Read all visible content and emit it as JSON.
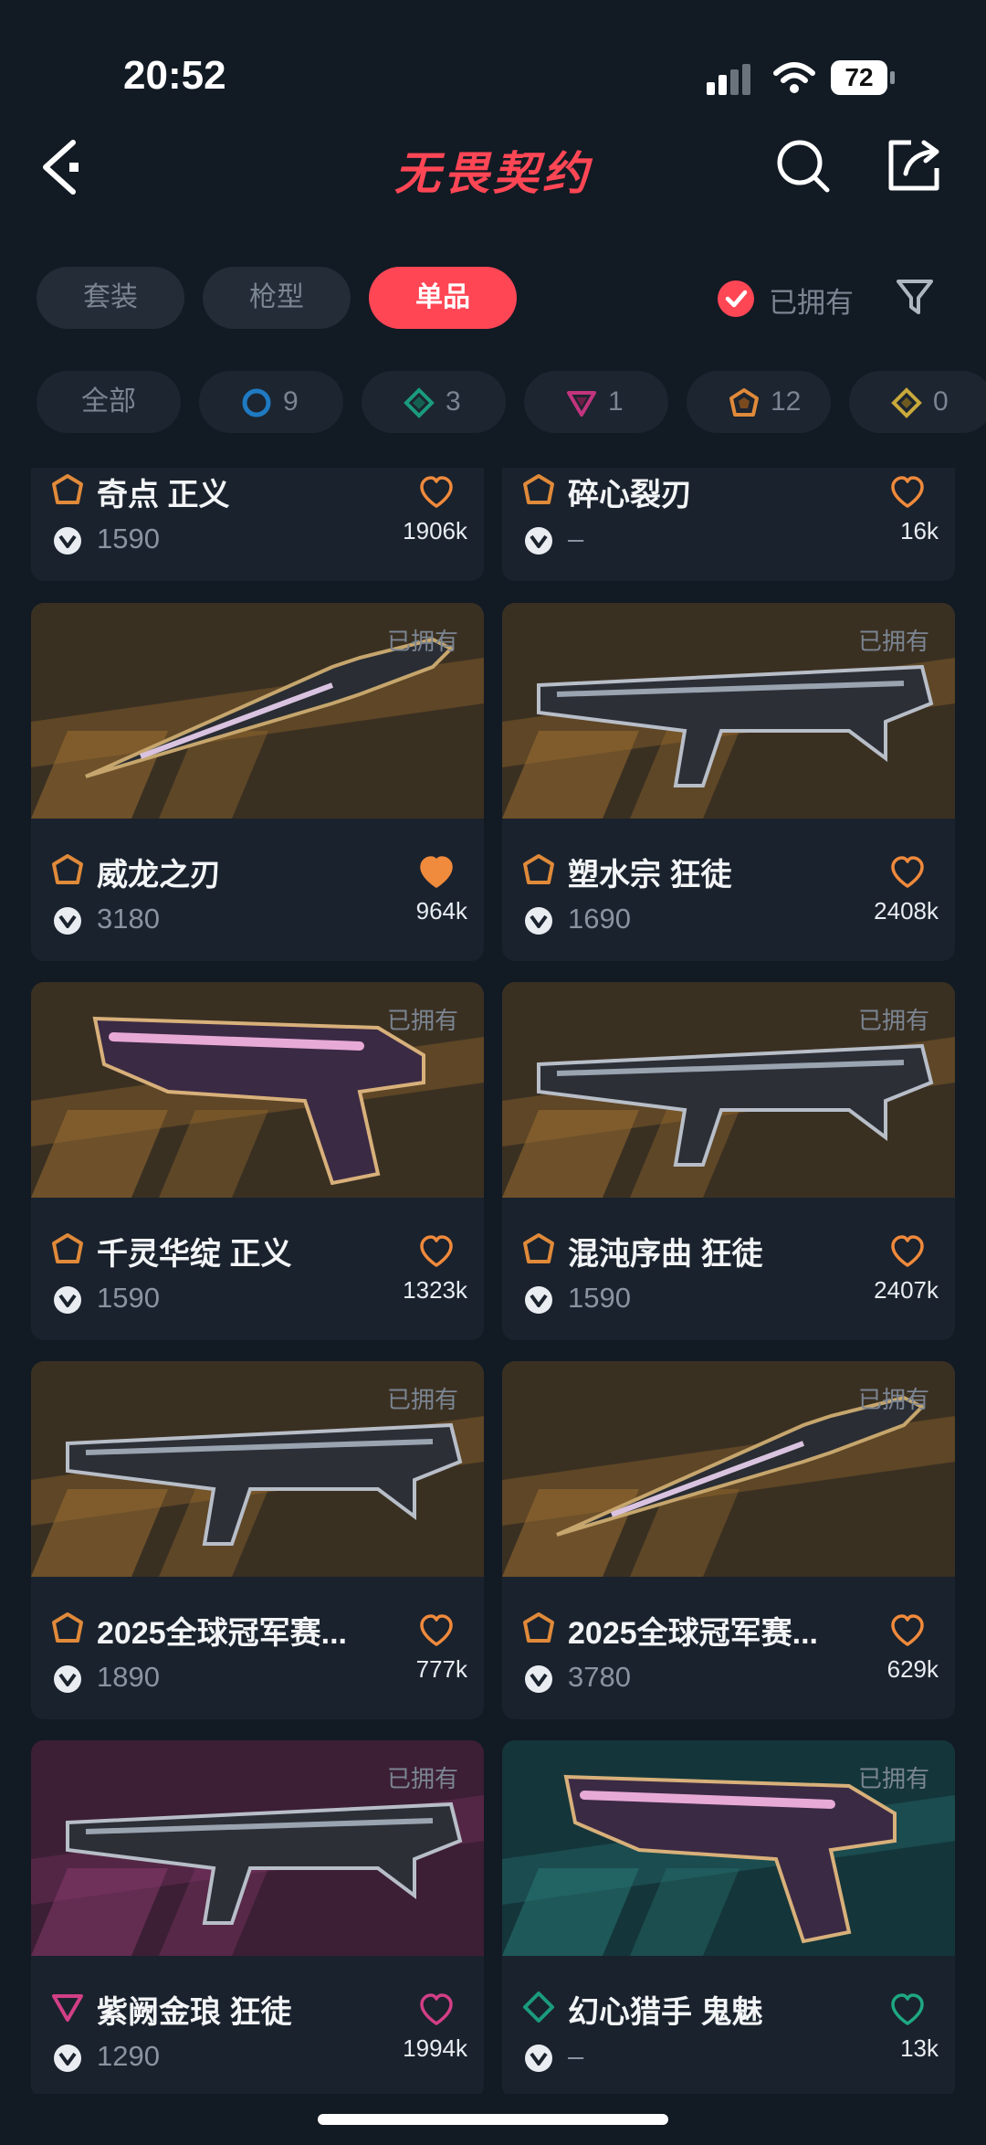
{
  "status_bar": {
    "time": "20:52",
    "battery": "72"
  },
  "header": {
    "title": "无畏契约"
  },
  "tabs": [
    {
      "label": "套装",
      "active": false
    },
    {
      "label": "枪型",
      "active": false
    },
    {
      "label": "单品",
      "active": true
    }
  ],
  "owned_filter": {
    "label": "已拥有",
    "checked": true
  },
  "rarity_chips": [
    {
      "label": "全部"
    },
    {
      "count": "9",
      "tier": "select",
      "color": "#1f7ac2"
    },
    {
      "count": "3",
      "tier": "deluxe",
      "color": "#1b9b7e"
    },
    {
      "count": "1",
      "tier": "premium",
      "color": "#c2347e"
    },
    {
      "count": "12",
      "tier": "exclusive",
      "color": "#e08a3a"
    },
    {
      "count": "0",
      "tier": "ultra",
      "color": "#c9a93b"
    }
  ],
  "cards": [
    {
      "name": "奇点 正义",
      "price": "1590",
      "likes": "1906k",
      "tier_color": "#e08a3a",
      "heart": "outline",
      "heart_color": "#f08a3c",
      "partial": true
    },
    {
      "name": "碎心裂刃",
      "price": "–",
      "likes": "16k",
      "tier_color": "#e08a3a",
      "heart": "outline",
      "heart_color": "#f08a3c",
      "partial": true
    },
    {
      "name": "威龙之刃",
      "price": "3180",
      "likes": "964k",
      "owned": "已拥有",
      "tier_color": "#e08a3a",
      "heart": "filled",
      "heart_color": "#f08a3c",
      "bg": "gold",
      "weapon": "knife"
    },
    {
      "name": "塑水宗 狂徒",
      "price": "1690",
      "likes": "2408k",
      "owned": "已拥有",
      "tier_color": "#e08a3a",
      "heart": "outline",
      "heart_color": "#f08a3c",
      "bg": "gold",
      "weapon": "rifle"
    },
    {
      "name": "千灵华绽 正义",
      "price": "1590",
      "likes": "1323k",
      "owned": "已拥有",
      "tier_color": "#e08a3a",
      "heart": "outline",
      "heart_color": "#f08a3c",
      "bg": "gold",
      "weapon": "pistol"
    },
    {
      "name": "混沌序曲 狂徒",
      "price": "1590",
      "likes": "2407k",
      "owned": "已拥有",
      "tier_color": "#e08a3a",
      "heart": "outline",
      "heart_color": "#f08a3c",
      "bg": "gold",
      "weapon": "rifle"
    },
    {
      "name": "2025全球冠军赛...",
      "price": "1890",
      "likes": "777k",
      "owned": "已拥有",
      "tier_color": "#e08a3a",
      "heart": "outline",
      "heart_color": "#f08a3c",
      "bg": "gold",
      "weapon": "rifle"
    },
    {
      "name": "2025全球冠军赛...",
      "price": "3780",
      "likes": "629k",
      "owned": "已拥有",
      "tier_color": "#e08a3a",
      "heart": "outline",
      "heart_color": "#f08a3c",
      "bg": "gold",
      "weapon": "knife"
    },
    {
      "name": "紫阙金琅 狂徒",
      "price": "1290",
      "likes": "1994k",
      "owned": "已拥有",
      "tier_color": "#d23f86",
      "heart": "outline",
      "heart_color": "#d23f86",
      "bg": "purple",
      "weapon": "rifle"
    },
    {
      "name": "幻心猎手 鬼魅",
      "price": "–",
      "likes": "13k",
      "owned": "已拥有",
      "tier_color": "#1b9b7e",
      "heart": "outline",
      "heart_color": "#1ea882",
      "bg": "teal",
      "weapon": "pistol"
    }
  ]
}
